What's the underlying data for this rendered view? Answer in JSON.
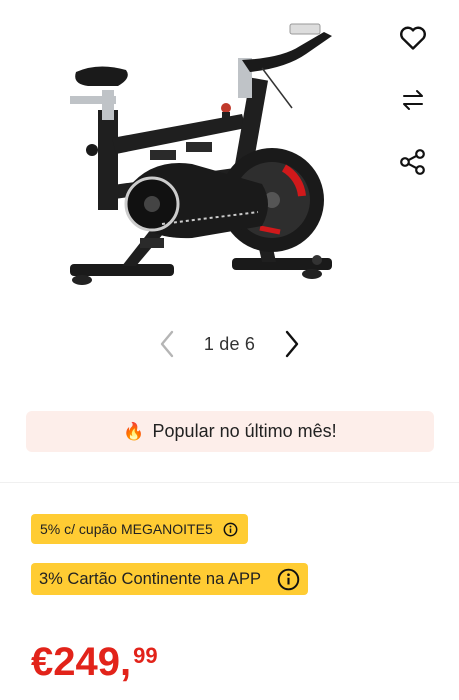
{
  "gallery": {
    "image_subject": "exercise spin bike",
    "counter": "1 de 6",
    "current_page": 1,
    "total_pages": 6
  },
  "actions": {
    "favorite_icon": "heart-icon",
    "compare_icon": "swap-arrows-icon",
    "share_icon": "share-icon"
  },
  "popular": {
    "emoji": "🔥",
    "text": "Popular no último mês!"
  },
  "promotions": {
    "coupon": "5% c/ cupão MEGANOITE5",
    "card": "3% Cartão Continente na APP"
  },
  "price": {
    "main": "€249,",
    "cents": "99"
  },
  "colors": {
    "price": "#e2231a",
    "badge": "#ffcc33",
    "banner": "#fdeeea"
  }
}
